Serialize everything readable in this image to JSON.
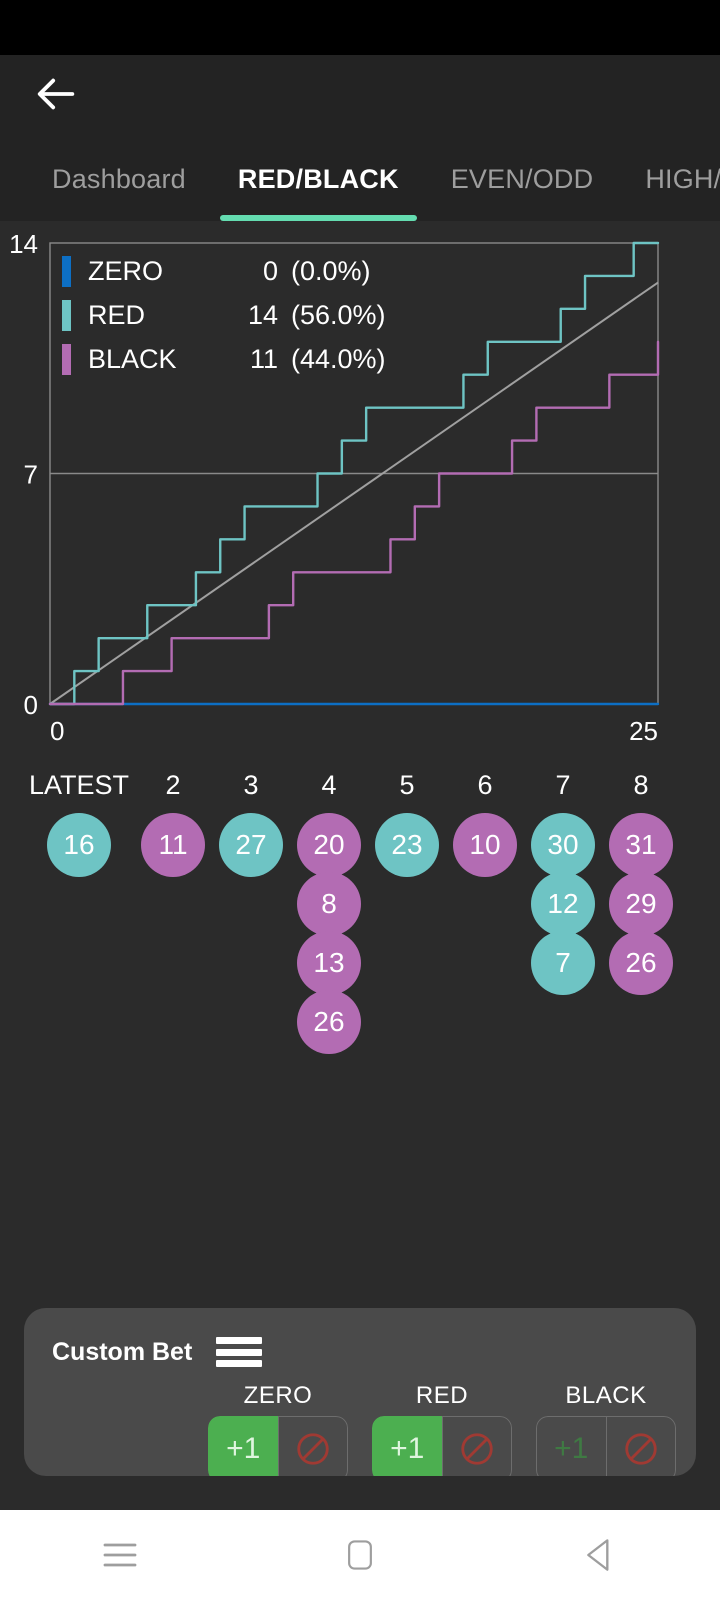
{
  "statusbar": {
    "name": "status-bar"
  },
  "appbar": {
    "back_icon": "arrow-left-icon",
    "tabs": [
      {
        "label": "Dashboard",
        "active": false
      },
      {
        "label": "RED/BLACK",
        "active": true
      },
      {
        "label": "EVEN/ODD",
        "active": false
      },
      {
        "label": "HIGH/",
        "active": false
      }
    ]
  },
  "chart_data": {
    "type": "line",
    "title": "",
    "xlabel": "",
    "ylabel": "",
    "xlim": [
      0,
      25
    ],
    "ylim": [
      0,
      14
    ],
    "xticks": [
      "0",
      "25"
    ],
    "yticks": [
      "0",
      "7",
      "14"
    ],
    "grid": true,
    "legend_position": "top-left",
    "x": [
      0,
      1,
      2,
      3,
      4,
      5,
      6,
      7,
      8,
      9,
      10,
      11,
      12,
      13,
      14,
      15,
      16,
      17,
      18,
      19,
      20,
      21,
      22,
      23,
      24,
      25
    ],
    "series": [
      {
        "name": "ZERO",
        "color": "#0d6fc4",
        "count": 0,
        "count_label": "0",
        "percent_label": "(0.0%)",
        "values": [
          0,
          0,
          0,
          0,
          0,
          0,
          0,
          0,
          0,
          0,
          0,
          0,
          0,
          0,
          0,
          0,
          0,
          0,
          0,
          0,
          0,
          0,
          0,
          0,
          0,
          0
        ]
      },
      {
        "name": "RED",
        "color": "#6ec4c4",
        "count": 14,
        "count_label": "14",
        "percent_label": "(56.0%)",
        "values": [
          0,
          1,
          2,
          2,
          3,
          3,
          4,
          5,
          6,
          6,
          6,
          7,
          8,
          9,
          9,
          9,
          9,
          10,
          11,
          11,
          11,
          12,
          13,
          13,
          14,
          14
        ]
      },
      {
        "name": "BLACK",
        "color": "#b36cb3",
        "count": 11,
        "count_label": "11",
        "percent_label": "(44.0%)",
        "values": [
          0,
          0,
          0,
          1,
          1,
          2,
          2,
          2,
          2,
          3,
          4,
          4,
          4,
          4,
          5,
          6,
          7,
          7,
          7,
          8,
          9,
          9,
          9,
          10,
          10,
          11
        ]
      }
    ],
    "reference_line": {
      "name": "expected",
      "color": "#a0a0a0",
      "from": [
        0,
        0
      ],
      "to": [
        25,
        12.8
      ]
    }
  },
  "history": {
    "columns": [
      {
        "header": "LATEST",
        "chips": [
          {
            "value": "16",
            "kind": "red"
          }
        ]
      },
      {
        "header": "2",
        "chips": [
          {
            "value": "11",
            "kind": "black"
          }
        ]
      },
      {
        "header": "3",
        "chips": [
          {
            "value": "27",
            "kind": "red"
          }
        ]
      },
      {
        "header": "4",
        "chips": [
          {
            "value": "20",
            "kind": "black"
          },
          {
            "value": "8",
            "kind": "black"
          },
          {
            "value": "13",
            "kind": "black"
          },
          {
            "value": "26",
            "kind": "black"
          }
        ]
      },
      {
        "header": "5",
        "chips": [
          {
            "value": "23",
            "kind": "red"
          }
        ]
      },
      {
        "header": "6",
        "chips": [
          {
            "value": "10",
            "kind": "black"
          }
        ]
      },
      {
        "header": "7",
        "chips": [
          {
            "value": "30",
            "kind": "red"
          },
          {
            "value": "12",
            "kind": "red"
          },
          {
            "value": "7",
            "kind": "red"
          }
        ]
      },
      {
        "header": "8",
        "chips": [
          {
            "value": "31",
            "kind": "black"
          },
          {
            "value": "29",
            "kind": "black"
          },
          {
            "value": "26",
            "kind": "black"
          }
        ]
      }
    ]
  },
  "custom_bet": {
    "title": "Custom Bet",
    "menu_icon": "hamburger-icon",
    "groups": [
      {
        "label": "ZERO",
        "plus_label": "+1",
        "plus_active": true,
        "ban_icon": "ban-icon"
      },
      {
        "label": "RED",
        "plus_label": "+1",
        "plus_active": true,
        "ban_icon": "ban-icon"
      },
      {
        "label": "BLACK",
        "plus_label": "+1",
        "plus_active": false,
        "ban_icon": "ban-icon"
      }
    ]
  },
  "system_nav": {
    "buttons": [
      {
        "icon": "menu-icon"
      },
      {
        "icon": "home-square-icon"
      },
      {
        "icon": "back-triangle-icon"
      }
    ]
  },
  "colors": {
    "accent": "#64dcb0",
    "red_series": "#6ec4c4",
    "black_series": "#b36cb3",
    "zero_series": "#0d6fc4",
    "reference": "#a0a0a0",
    "green_button": "#4caf50",
    "background": "#2b2b2b",
    "appbar": "#232323",
    "panel": "#4a4a4a"
  }
}
